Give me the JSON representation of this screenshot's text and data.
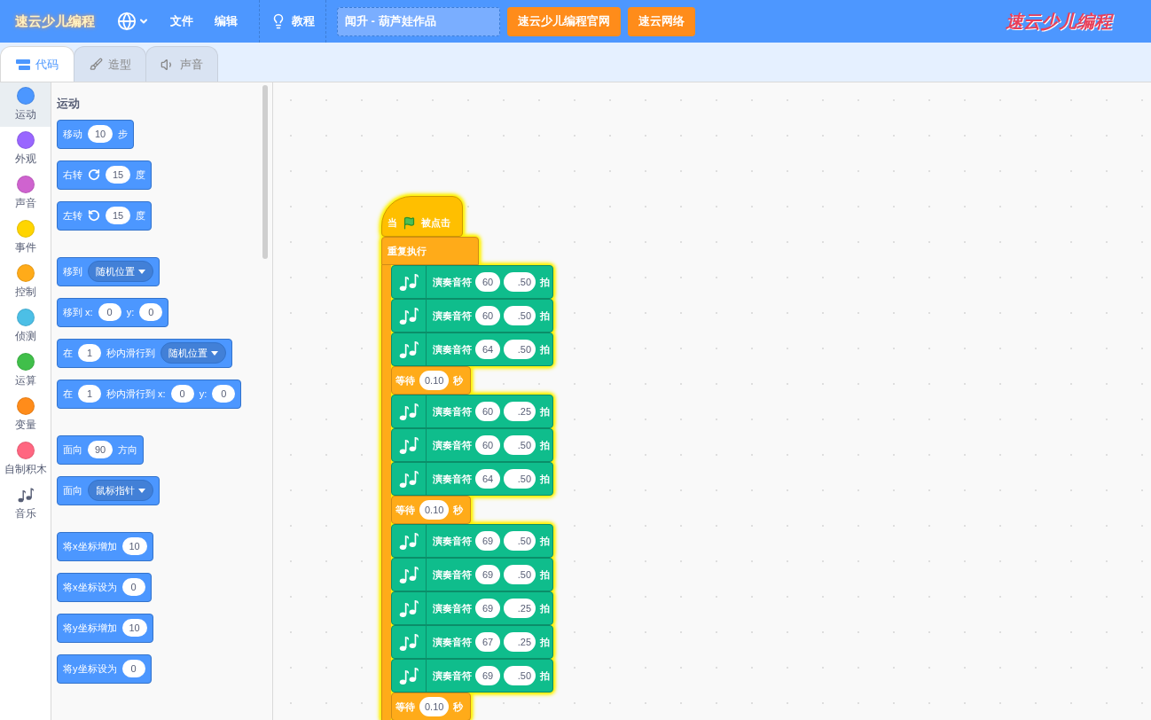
{
  "menu_bar": {
    "logo": "速云少儿编程",
    "menus": [
      "文件",
      "编辑"
    ],
    "tutorial": "教程",
    "project_title": "闻升 - 葫芦娃作品",
    "buttons": [
      "速云少儿编程官网",
      "速云网络"
    ],
    "brand": "速云少儿编程"
  },
  "tabs": [
    {
      "label": "代码",
      "kind": "code",
      "selected": true
    },
    {
      "label": "造型",
      "kind": "brush",
      "selected": false
    },
    {
      "label": "声音",
      "kind": "sound",
      "selected": false
    }
  ],
  "categories": [
    {
      "label": "运动",
      "kind": "dot",
      "color": "#4c97ff",
      "selected": true
    },
    {
      "label": "外观",
      "kind": "dot",
      "color": "#9966ff",
      "selected": false
    },
    {
      "label": "声音",
      "kind": "dot",
      "color": "#cf63cf",
      "selected": false
    },
    {
      "label": "事件",
      "kind": "dot",
      "color": "#ffd500",
      "selected": false
    },
    {
      "label": "控制",
      "kind": "dot",
      "color": "#ffab19",
      "selected": false
    },
    {
      "label": "侦测",
      "kind": "dot",
      "color": "#4cbfe6",
      "selected": false
    },
    {
      "label": "运算",
      "kind": "dot",
      "color": "#40bf4a",
      "selected": false
    },
    {
      "label": "变量",
      "kind": "dot",
      "color": "#ff8c1a",
      "selected": false
    },
    {
      "label": "自制积木",
      "kind": "dot",
      "color": "#ff6680",
      "selected": false
    },
    {
      "label": "音乐",
      "kind": "icon",
      "selected": false
    }
  ],
  "palette": {
    "heading": "运动",
    "groups": [
      [
        [
          {
            "kind": "text",
            "text": "移动"
          },
          {
            "kind": "input",
            "text": "10"
          },
          {
            "kind": "text",
            "text": "步"
          }
        ],
        [
          {
            "kind": "text",
            "text": "右转"
          },
          {
            "kind": "turn-right"
          },
          {
            "kind": "input",
            "text": "15"
          },
          {
            "kind": "text",
            "text": "度"
          }
        ],
        [
          {
            "kind": "text",
            "text": "左转"
          },
          {
            "kind": "turn-left"
          },
          {
            "kind": "input",
            "text": "15"
          },
          {
            "kind": "text",
            "text": "度"
          }
        ]
      ],
      [
        [
          {
            "kind": "text",
            "text": "移到"
          },
          {
            "kind": "dropdown",
            "text": "随机位置"
          }
        ],
        [
          {
            "kind": "text",
            "text": "移到 x:"
          },
          {
            "kind": "input",
            "text": "0"
          },
          {
            "kind": "text",
            "text": "y:"
          },
          {
            "kind": "input",
            "text": "0"
          }
        ],
        [
          {
            "kind": "text",
            "text": "在"
          },
          {
            "kind": "input",
            "text": "1"
          },
          {
            "kind": "text",
            "text": "秒内滑行到"
          },
          {
            "kind": "dropdown",
            "text": "随机位置"
          }
        ],
        [
          {
            "kind": "text",
            "text": "在"
          },
          {
            "kind": "input",
            "text": "1"
          },
          {
            "kind": "text",
            "text": "秒内滑行到 x:"
          },
          {
            "kind": "input",
            "text": "0"
          },
          {
            "kind": "text",
            "text": "y:"
          },
          {
            "kind": "input",
            "text": "0"
          }
        ]
      ],
      [
        [
          {
            "kind": "text",
            "text": "面向"
          },
          {
            "kind": "input",
            "text": "90"
          },
          {
            "kind": "text",
            "text": "方向"
          }
        ],
        [
          {
            "kind": "text",
            "text": "面向"
          },
          {
            "kind": "dropdown",
            "text": "鼠标指针"
          }
        ]
      ],
      [
        [
          {
            "kind": "text",
            "text": "将x坐标增加"
          },
          {
            "kind": "input",
            "text": "10"
          }
        ],
        [
          {
            "kind": "text",
            "text": "将x坐标设为"
          },
          {
            "kind": "input",
            "text": "0"
          }
        ],
        [
          {
            "kind": "text",
            "text": "将y坐标增加"
          },
          {
            "kind": "input",
            "text": "10"
          }
        ],
        [
          {
            "kind": "text",
            "text": "将y坐标设为"
          },
          {
            "kind": "input",
            "text": "0"
          }
        ]
      ]
    ]
  },
  "script": {
    "running": true,
    "hat": {
      "before": "当",
      "after": "被点击"
    },
    "loop": "重复执行",
    "blocks": [
      {
        "kind": "note",
        "label": "演奏音符",
        "note": "60",
        "beats": ".50",
        "unit": "拍"
      },
      {
        "kind": "note",
        "label": "演奏音符",
        "note": "60",
        "beats": ".50",
        "unit": "拍"
      },
      {
        "kind": "note",
        "label": "演奏音符",
        "note": "64",
        "beats": ".50",
        "unit": "拍"
      },
      {
        "kind": "wait",
        "label": "等待",
        "value": "0.10",
        "unit": "秒"
      },
      {
        "kind": "note",
        "label": "演奏音符",
        "note": "60",
        "beats": ".25",
        "unit": "拍"
      },
      {
        "kind": "note",
        "label": "演奏音符",
        "note": "60",
        "beats": ".50",
        "unit": "拍"
      },
      {
        "kind": "note",
        "label": "演奏音符",
        "note": "64",
        "beats": ".50",
        "unit": "拍"
      },
      {
        "kind": "wait",
        "label": "等待",
        "value": "0.10",
        "unit": "秒"
      },
      {
        "kind": "note",
        "label": "演奏音符",
        "note": "69",
        "beats": ".50",
        "unit": "拍"
      },
      {
        "kind": "note",
        "label": "演奏音符",
        "note": "69",
        "beats": ".50",
        "unit": "拍"
      },
      {
        "kind": "note",
        "label": "演奏音符",
        "note": "69",
        "beats": ".25",
        "unit": "拍"
      },
      {
        "kind": "note",
        "label": "演奏音符",
        "note": "67",
        "beats": ".25",
        "unit": "拍"
      },
      {
        "kind": "note",
        "label": "演奏音符",
        "note": "69",
        "beats": ".50",
        "unit": "拍"
      },
      {
        "kind": "wait",
        "label": "等待",
        "value": "0.10",
        "unit": "秒"
      }
    ]
  }
}
